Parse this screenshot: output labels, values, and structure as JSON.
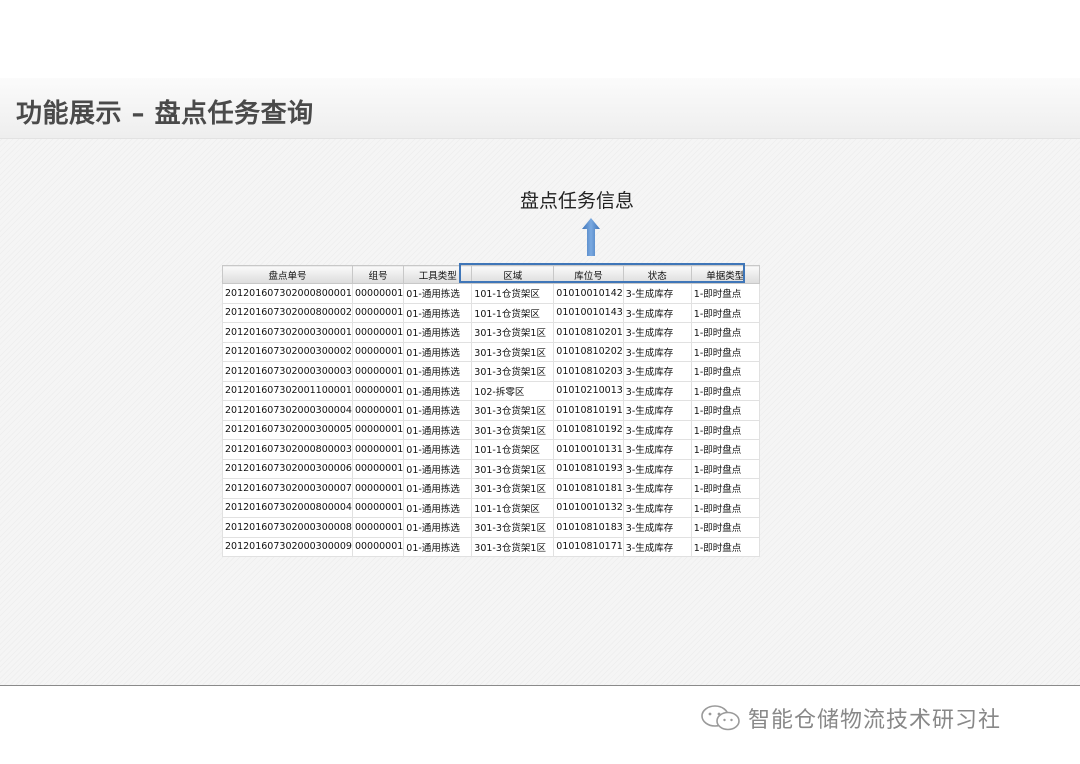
{
  "slide": {
    "title": "功能展示 – 盘点任务查询"
  },
  "callout": {
    "label": "盘点任务信息"
  },
  "table": {
    "columns": [
      "盘点单号",
      "组号",
      "工具类型",
      "区域",
      "库位号",
      "状态",
      "单据类型"
    ],
    "rows": [
      [
        "201201607302000800001",
        "00000001",
        "01-通用拣选",
        "101-1仓货架区",
        "01010010142",
        "3-生成库存",
        "1-即时盘点"
      ],
      [
        "201201607302000800002",
        "00000001",
        "01-通用拣选",
        "101-1仓货架区",
        "01010010143",
        "3-生成库存",
        "1-即时盘点"
      ],
      [
        "201201607302000300001",
        "00000001",
        "01-通用拣选",
        "301-3仓货架1区",
        "01010810201",
        "3-生成库存",
        "1-即时盘点"
      ],
      [
        "201201607302000300002",
        "00000001",
        "01-通用拣选",
        "301-3仓货架1区",
        "01010810202",
        "3-生成库存",
        "1-即时盘点"
      ],
      [
        "201201607302000300003",
        "00000001",
        "01-通用拣选",
        "301-3仓货架1区",
        "01010810203",
        "3-生成库存",
        "1-即时盘点"
      ],
      [
        "201201607302001100001",
        "00000001",
        "01-通用拣选",
        "102-拆零区",
        "01010210013",
        "3-生成库存",
        "1-即时盘点"
      ],
      [
        "201201607302000300004",
        "00000001",
        "01-通用拣选",
        "301-3仓货架1区",
        "01010810191",
        "3-生成库存",
        "1-即时盘点"
      ],
      [
        "201201607302000300005",
        "00000001",
        "01-通用拣选",
        "301-3仓货架1区",
        "01010810192",
        "3-生成库存",
        "1-即时盘点"
      ],
      [
        "201201607302000800003",
        "00000001",
        "01-通用拣选",
        "101-1仓货架区",
        "01010010131",
        "3-生成库存",
        "1-即时盘点"
      ],
      [
        "201201607302000300006",
        "00000001",
        "01-通用拣选",
        "301-3仓货架1区",
        "01010810193",
        "3-生成库存",
        "1-即时盘点"
      ],
      [
        "201201607302000300007",
        "00000001",
        "01-通用拣选",
        "301-3仓货架1区",
        "01010810181",
        "3-生成库存",
        "1-即时盘点"
      ],
      [
        "201201607302000800004",
        "00000001",
        "01-通用拣选",
        "101-1仓货架区",
        "01010010132",
        "3-生成库存",
        "1-即时盘点"
      ],
      [
        "201201607302000300008",
        "00000001",
        "01-通用拣选",
        "301-3仓货架1区",
        "01010810183",
        "3-生成库存",
        "1-即时盘点"
      ],
      [
        "201201607302000300009",
        "00000001",
        "01-通用拣选",
        "301-3仓货架1区",
        "01010810171",
        "3-生成库存",
        "1-即时盘点"
      ]
    ]
  },
  "watermark": {
    "icon": "wechat-icon",
    "text": "智能仓储物流技术研习社"
  },
  "colors": {
    "accent": "#3f76b8",
    "arrow": "#5b8fd0"
  }
}
